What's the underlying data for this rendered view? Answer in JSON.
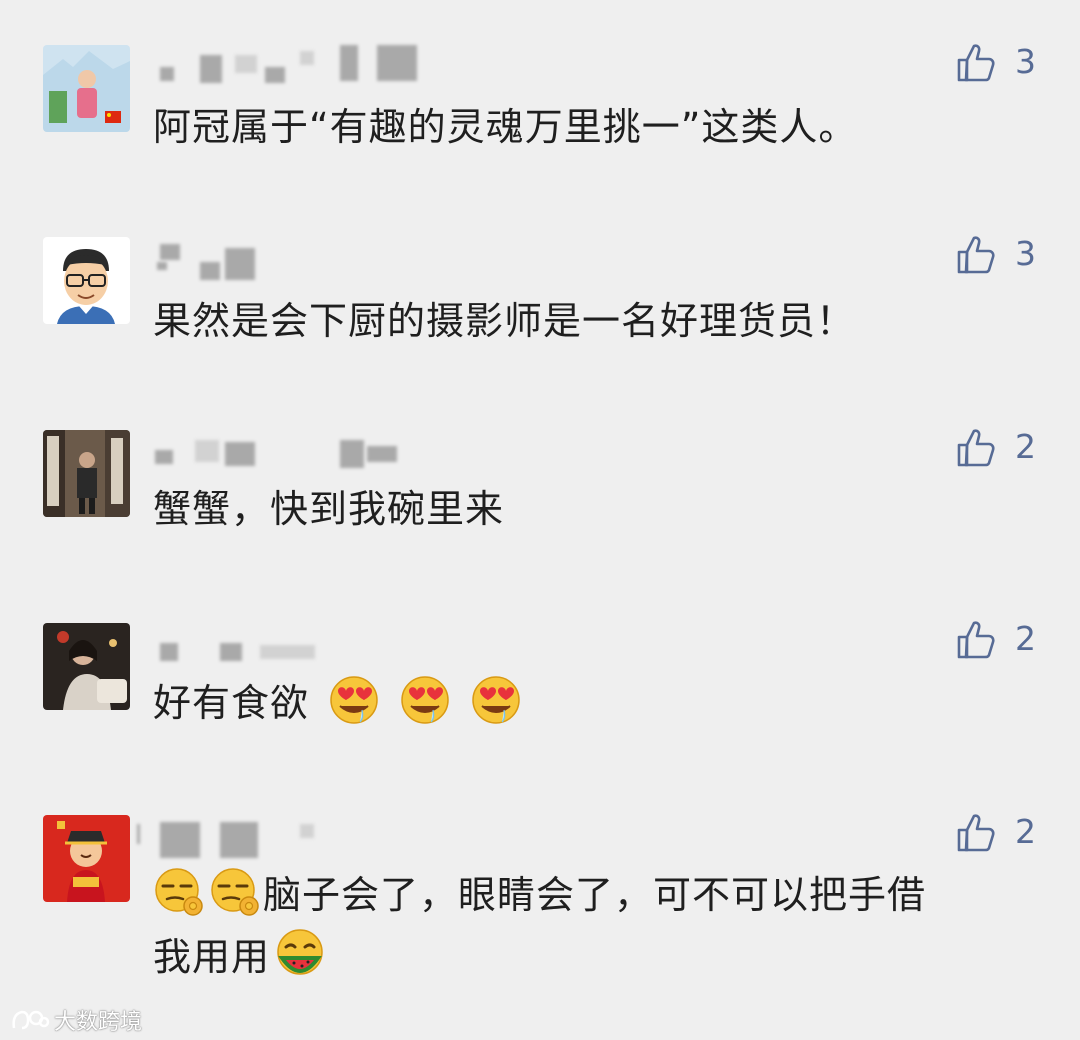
{
  "comments": [
    {
      "text": "阿冠属于“有趣的灵魂万里挑一”这类人。",
      "likes": "3",
      "emojis_after": []
    },
    {
      "text": "果然是会下厨的摄影师是一名好理货员！",
      "likes": "3",
      "emojis_after": []
    },
    {
      "text": "蟹蟹，快到我碗里来",
      "likes": "2",
      "emojis_after": []
    },
    {
      "text": "好有食欲",
      "likes": "2",
      "emojis_after": [
        "heart-eyes-drool-emoji",
        "heart-eyes-drool-emoji",
        "heart-eyes-drool-emoji"
      ]
    },
    {
      "text_line1": "脑子会了，眼睛会了，可不可以把手借",
      "text_line2": "我用用",
      "likes": "2",
      "emojis_before": [
        "ok-hand-smirk-emoji",
        "ok-hand-smirk-emoji"
      ],
      "emojis_after": [
        "eating-watermelon-emoji"
      ]
    }
  ],
  "watermark": {
    "text": "大数跨境"
  },
  "colors": {
    "background": "#efefef",
    "like_blue": "#576b95",
    "text": "#1f1f1f"
  }
}
